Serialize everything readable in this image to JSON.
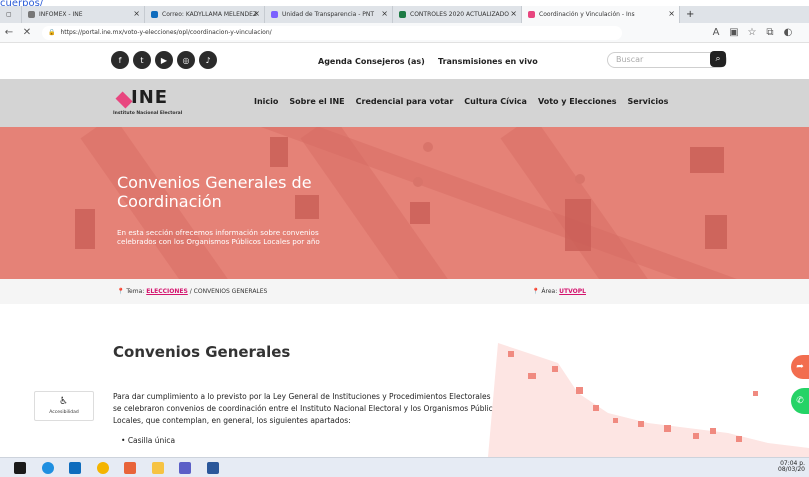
{
  "browser": {
    "top_link": "cuerpos/",
    "tabs": [
      {
        "label": "INFOMEX - INE",
        "color": "#777777"
      },
      {
        "label": "Correo: KADYLLAMA MELENDEZ",
        "color": "#0f6cbd"
      },
      {
        "label": "Unidad de Transparencia - PNT",
        "color": "#7b61ff"
      },
      {
        "label": "CONTROLES 2020 ACTUALIZADO",
        "color": "#1e7b45"
      },
      {
        "label": "Coordinación y Vinculación - Ins",
        "color": "#e8467f"
      }
    ],
    "url": "https://portal.ine.mx/voto-y-elecciones/opl/coordinacion-y-vinculacion/"
  },
  "site": {
    "topbar": {
      "social_icons": [
        "facebook-icon",
        "twitter-icon",
        "youtube-icon",
        "instagram-icon",
        "tiktok-icon"
      ],
      "agenda": "Agenda Consejeros (as)",
      "transmisiones": "Transmisiones en vivo",
      "search_placeholder": "Buscar"
    },
    "logo": {
      "text": "INE",
      "subtitle": "Instituto Nacional Electoral"
    },
    "menu": [
      "Inicio",
      "Sobre el INE",
      "Credencial para votar",
      "Cultura Cívica",
      "Voto y Elecciones",
      "Servicios"
    ],
    "hero": {
      "title": "Convenios Generales de Coordinación",
      "description": "En esta sección ofrecemos información sobre convenios celebrados con los Organismos Públicos Locales por año"
    },
    "breadcrumb": {
      "tema_label": "Tema:",
      "tema_link": "ELECCIONES",
      "tema_rest": "/ CONVENIOS GENERALES",
      "area_label": "Área:",
      "area_link": "UTVOPL"
    },
    "section_title": "Convenios Generales",
    "body_text": "Para dar cumplimiento a lo previsto por la Ley General de Instituciones y Procedimientos Electorales (LEGIPE), se celebraron convenios de coordinación entre el Instituto Nacional Electoral y los Organismos Públicos Locales, que contemplan, en general, los siguientes apartados:",
    "bullet_1": "Casilla única",
    "accessibility_label": "Accesibilidad"
  },
  "taskbar": {
    "time": "07:04 p.",
    "date": "08/03/20"
  },
  "colors": {
    "accent": "#e8467f",
    "hero": "#e58277",
    "link": "#d4146e"
  }
}
